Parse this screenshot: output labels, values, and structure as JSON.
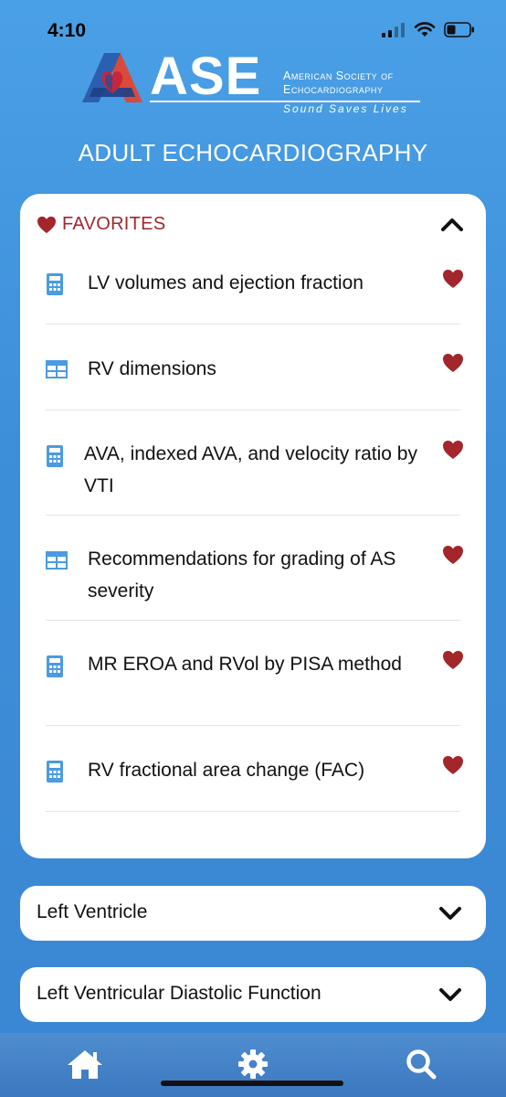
{
  "status_bar": {
    "time": "4:10"
  },
  "brand": {
    "logo_text": "ASE",
    "org_line1": "American Society of",
    "org_line2": "Echocardiography",
    "tagline": "Sound Saves Lives"
  },
  "page_title": "ADULT ECHOCARDIOGRAPHY",
  "favorites": {
    "label": "FAVORITES",
    "items": [
      {
        "label": "LV volumes and ejection fraction",
        "icon": "calculator-icon"
      },
      {
        "label": "RV dimensions",
        "icon": "table-icon"
      },
      {
        "label": "AVA, indexed AVA, and velocity ratio by VTI",
        "icon": "calculator-icon"
      },
      {
        "label": "Recommendations for grading of AS severity",
        "icon": "table-icon"
      },
      {
        "label": "MR EROA and RVol by PISA method",
        "icon": "calculator-icon"
      },
      {
        "label": "RV fractional area change (FAC)",
        "icon": "calculator-icon"
      }
    ]
  },
  "sections": [
    {
      "label": "Left Ventricle"
    },
    {
      "label": "Left Ventricular Diastolic Function"
    }
  ],
  "tabs": [
    {
      "icon": "home-icon"
    },
    {
      "icon": "settings-gear-icon"
    },
    {
      "icon": "search-icon"
    }
  ],
  "colors": {
    "accent_red": "#a2262b",
    "icon_blue": "#4a9be0",
    "background_blue": "#3d8fd9"
  }
}
